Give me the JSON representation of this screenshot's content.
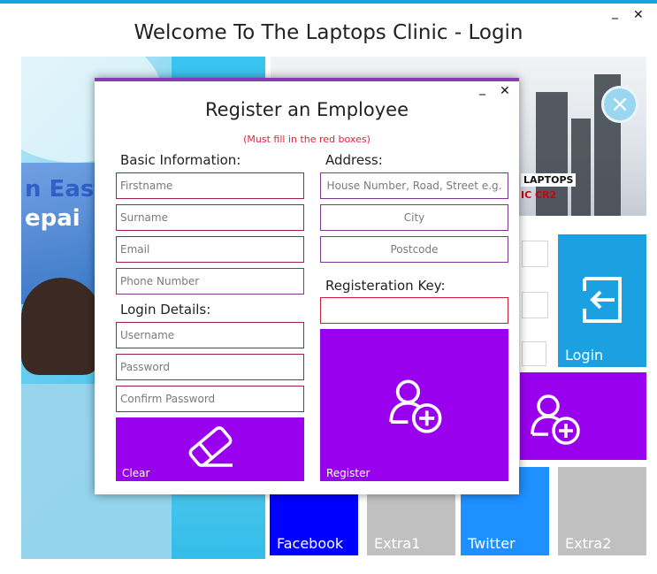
{
  "window": {
    "title": "Welcome To The Laptops Clinic - Login",
    "minimize_glyph": "_",
    "close_glyph": "✕"
  },
  "background": {
    "poster_text_left": "n East",
    "poster_text_left2": "epai",
    "poster_text_right": "LAPTOPS",
    "poster_text_right2": "IC  CR2",
    "tiles": {
      "login": "Login",
      "facebook": "Facebook",
      "extra1": "Extra1",
      "twitter": "Twitter",
      "extra2": "Extra2"
    }
  },
  "dialog": {
    "title": "Register an Employee",
    "note": "(Must fill in the red boxes)",
    "minimize_glyph": "_",
    "close_glyph": "✕",
    "basic": {
      "heading": "Basic Information:",
      "firstname_placeholder": "Firstname",
      "surname_placeholder": "Surname",
      "email_placeholder": "Email",
      "phone_placeholder": "Phone Number"
    },
    "login": {
      "heading": "Login Details:",
      "username_placeholder": "Username",
      "password_placeholder": "Password",
      "confirm_placeholder": "Confirm Password"
    },
    "address": {
      "heading": "Address:",
      "house_placeholder": "House Number, Road, Street e.g.",
      "city_placeholder": "City",
      "postcode_placeholder": "Postcode"
    },
    "key": {
      "heading": "Registeration Key:",
      "value": ""
    },
    "buttons": {
      "clear": "Clear",
      "register": "Register"
    }
  },
  "colors": {
    "accent_blue": "#1ba1e2",
    "purple_tile": "#9900ee",
    "facebook_blue": "#0000ff",
    "twitter_blue": "#1e90ff",
    "grey_tile": "#c0c0c0",
    "required_border": "#a0224a"
  },
  "icons": {
    "login_tile": "sign-in-icon",
    "add_user": "add-user-icon",
    "clear": "eraser-icon",
    "background_close": "close-circle-icon"
  }
}
